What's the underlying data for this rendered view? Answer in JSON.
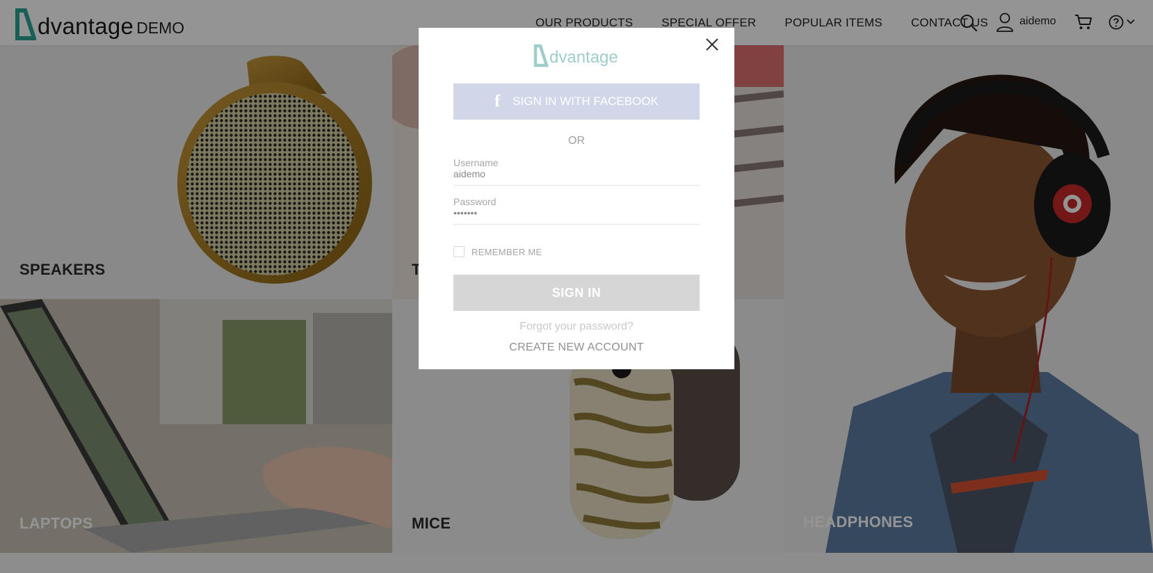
{
  "brand": {
    "name": "dvantage",
    "suffix": "DEMO",
    "accent": "#2aa597"
  },
  "nav": {
    "items": [
      "OUR PRODUCTS",
      "SPECIAL OFFER",
      "POPULAR ITEMS",
      "CONTACT US"
    ],
    "user": "aidemo",
    "icons": [
      "search-icon",
      "user-icon",
      "cart-icon",
      "help-icon",
      "chevron-down-icon"
    ]
  },
  "categories": [
    {
      "label": "SPEAKERS"
    },
    {
      "label": "T"
    },
    {
      "label": "HEADPHONES"
    },
    {
      "label": "LAPTOPS"
    },
    {
      "label": "MICE"
    }
  ],
  "login": {
    "logo_text": "dvantage",
    "facebook_label": "SIGN IN WITH FACEBOOK",
    "or_label": "OR",
    "username_label": "Username",
    "username_value": "aidemo",
    "password_label": "Password",
    "password_value": "•••••••",
    "remember_label": "REMEMBER ME",
    "signin_label": "SIGN IN",
    "forgot_label": "Forgot your password?",
    "create_label": "CREATE NEW ACCOUNT",
    "facebook_color": "#d0d7e8",
    "signin_color": "#d6d6d6"
  }
}
